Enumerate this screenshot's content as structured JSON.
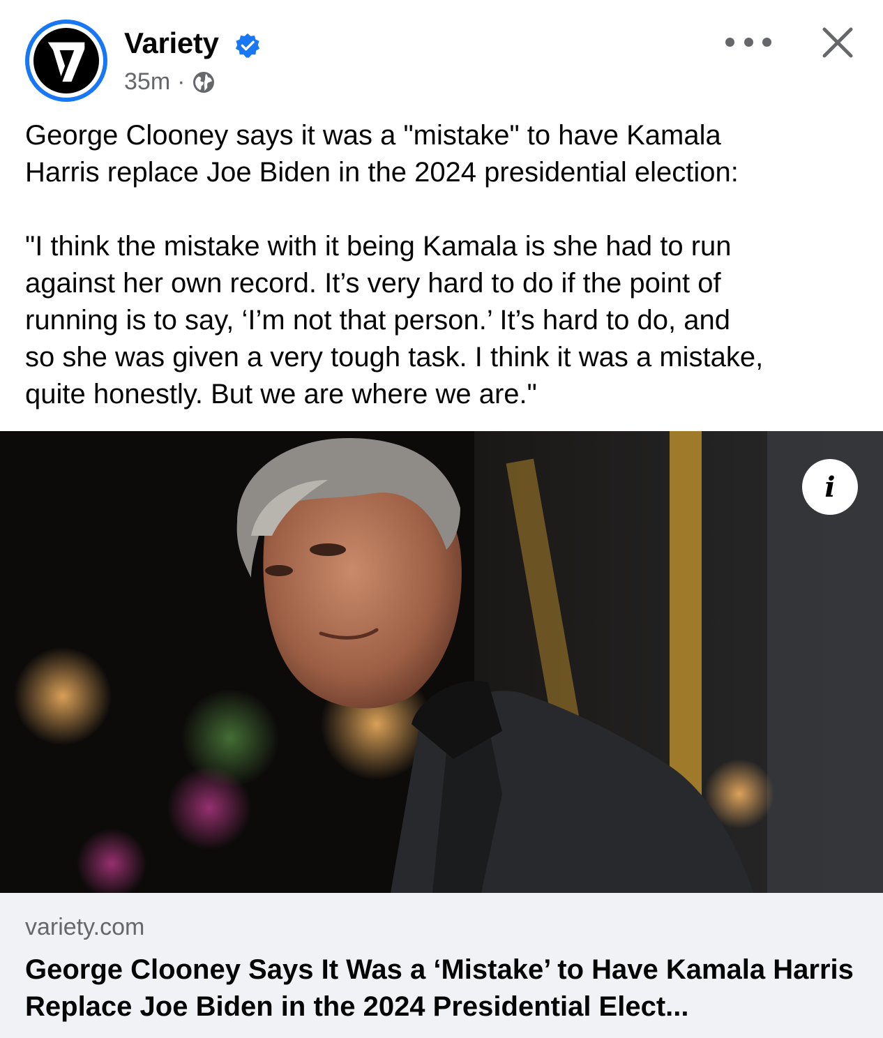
{
  "post": {
    "page_name": "Variety",
    "time": "35m",
    "separator": "·",
    "text_lines": [
      "George Clooney says it was a \"mistake\" to have Kamala",
      "Harris replace Joe Biden in the 2024 presidential election:"
    ],
    "quote_lines": [
      "\"I think the mistake with it being Kamala is she had to run",
      "against her own record. It’s very hard to do if the point of",
      "running is to say, ‘I’m not that person.’ It’s hard to do, and",
      "so she was given a very tough task. I think it was a mistake,",
      "quite honestly. But we are where we are.\""
    ]
  },
  "icons": {
    "avatar": "variety-logo-icon",
    "verified": "verified-badge-icon",
    "audience": "globe-icon",
    "more": "more-options-icon",
    "close": "close-icon",
    "info": "info-icon"
  },
  "media": {
    "info_label": "i"
  },
  "link_preview": {
    "domain": "variety.com",
    "headline": "George Clooney Says It Was a ‘Mistake’ to Have Kamala Harris Replace Joe Biden in the 2024 Presidential Elect..."
  },
  "colors": {
    "accent": "#1877f2",
    "secondary_text": "#65676b",
    "card_bg": "#f0f2f5"
  }
}
